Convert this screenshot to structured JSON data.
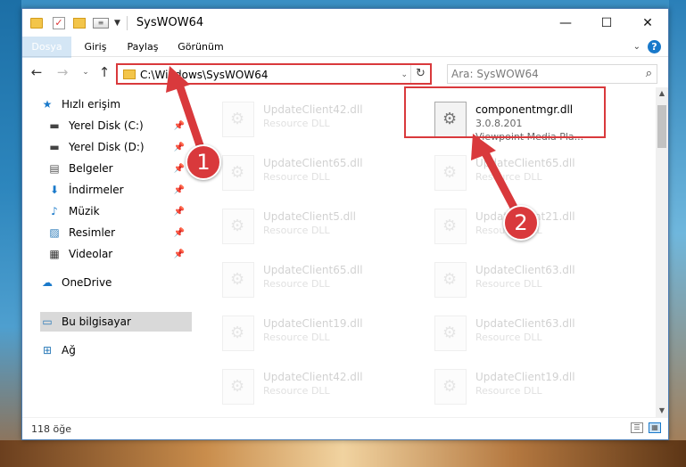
{
  "window": {
    "title": "SysWOW64"
  },
  "ribbon": {
    "tabs": [
      "Dosya",
      "Giriş",
      "Paylaş",
      "Görünüm"
    ]
  },
  "address": {
    "path": "C:\\Windows\\SysWOW64"
  },
  "search": {
    "placeholder": "Ara: SysWOW64"
  },
  "sidebar": {
    "items": [
      {
        "label": "Hızlı erişim",
        "icon": "star-icon"
      },
      {
        "label": "Yerel Disk (C:)",
        "icon": "drive-icon"
      },
      {
        "label": "Yerel Disk (D:)",
        "icon": "drive-icon"
      },
      {
        "label": "Belgeler",
        "icon": "documents-icon"
      },
      {
        "label": "İndirmeler",
        "icon": "download-icon"
      },
      {
        "label": "Müzik",
        "icon": "music-icon"
      },
      {
        "label": "Resimler",
        "icon": "pictures-icon"
      },
      {
        "label": "Videolar",
        "icon": "videos-icon"
      },
      {
        "label": "OneDrive",
        "icon": "cloud-icon"
      },
      {
        "label": "Bu bilgisayar",
        "icon": "computer-icon"
      },
      {
        "label": "Ağ",
        "icon": "network-icon"
      }
    ]
  },
  "files": {
    "left": [
      {
        "name": "UpdateClient42.dll",
        "type": "Resource DLL"
      },
      {
        "name": "UpdateClient65.dll",
        "type": "Resource DLL"
      },
      {
        "name": "UpdateClient5.dll",
        "type": "Resource DLL"
      },
      {
        "name": "UpdateClient65.dll",
        "type": "Resource DLL"
      },
      {
        "name": "UpdateClient19.dll",
        "type": "Resource DLL"
      },
      {
        "name": "UpdateClient42.dll",
        "type": "Resource DLL"
      }
    ],
    "right": [
      {
        "name": "UpdateClient65.dll",
        "type": "Resource DLL"
      },
      {
        "name": "UpdateClient21.dll",
        "type": "Resource DLL"
      },
      {
        "name": "UpdateClient63.dll",
        "type": "Resource DLL"
      },
      {
        "name": "UpdateClient63.dll",
        "type": "Resource DLL"
      },
      {
        "name": "UpdateClient19.dll",
        "type": "Resource DLL"
      }
    ],
    "highlighted": {
      "name": "componentmgr.dll",
      "version": "3.0.8.201",
      "type": "Viewpoint Media Pla..."
    }
  },
  "status": {
    "count": "118 öğe"
  },
  "annotations": {
    "step1": "1",
    "step2": "2",
    "color": "#d9393c"
  }
}
